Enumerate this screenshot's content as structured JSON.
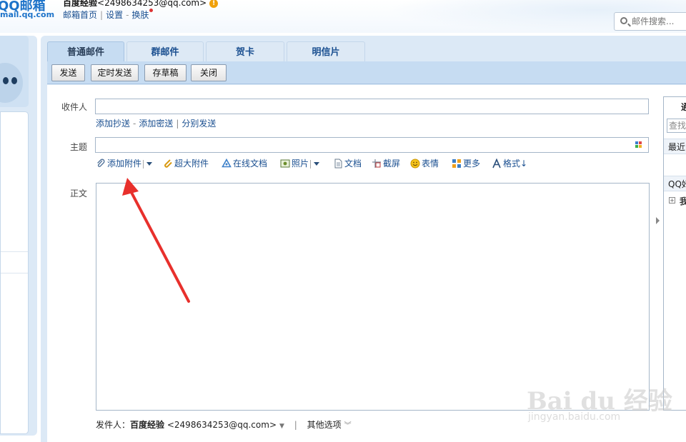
{
  "header": {
    "logo": "QQ邮箱",
    "logo_domain": "mail.qq.com",
    "user_name": "百度经验",
    "user_email": "<2498634253@qq.com>",
    "links": [
      "邮箱首页",
      "设置",
      "换肤"
    ],
    "search_placeholder": "邮件搜索..."
  },
  "tabs": [
    {
      "label": "普通邮件",
      "active": true
    },
    {
      "label": "群邮件",
      "active": false
    },
    {
      "label": "贺卡",
      "active": false
    },
    {
      "label": "明信片",
      "active": false
    }
  ],
  "toolbar": {
    "send": "发送",
    "schedule": "定时发送",
    "draft": "存草稿",
    "close": "关闭"
  },
  "form": {
    "to_label": "收件人",
    "cc_link": "添加抄送",
    "bcc_link": "添加密送",
    "separate_link": "分别发送",
    "subject_label": "主题",
    "body_label": "正文"
  },
  "attach_bar": {
    "add_attachment": "添加附件",
    "large_attachment": "超大附件",
    "online_doc": "在线文档",
    "photo": "照片",
    "document": "文档",
    "screenshot": "截屏",
    "emoji": "表情",
    "more": "更多",
    "format": "格式↓"
  },
  "sender": {
    "label": "发件人：",
    "name": "百度经验",
    "email": "<2498634253@qq.com>",
    "other_options": "其他选项"
  },
  "right_panel": {
    "title": "通",
    "search": "查找",
    "recent": "最近",
    "qq_friends": "QQ好",
    "my_group": "我"
  },
  "watermark": {
    "text": "Bai du 经验",
    "url": "jingyan.baidu.com"
  },
  "colors": {
    "frame": "#dce9f6",
    "tab_active": "#c6dcf2",
    "link": "#1a4f90",
    "annotation_arrow": "#e8302c"
  }
}
